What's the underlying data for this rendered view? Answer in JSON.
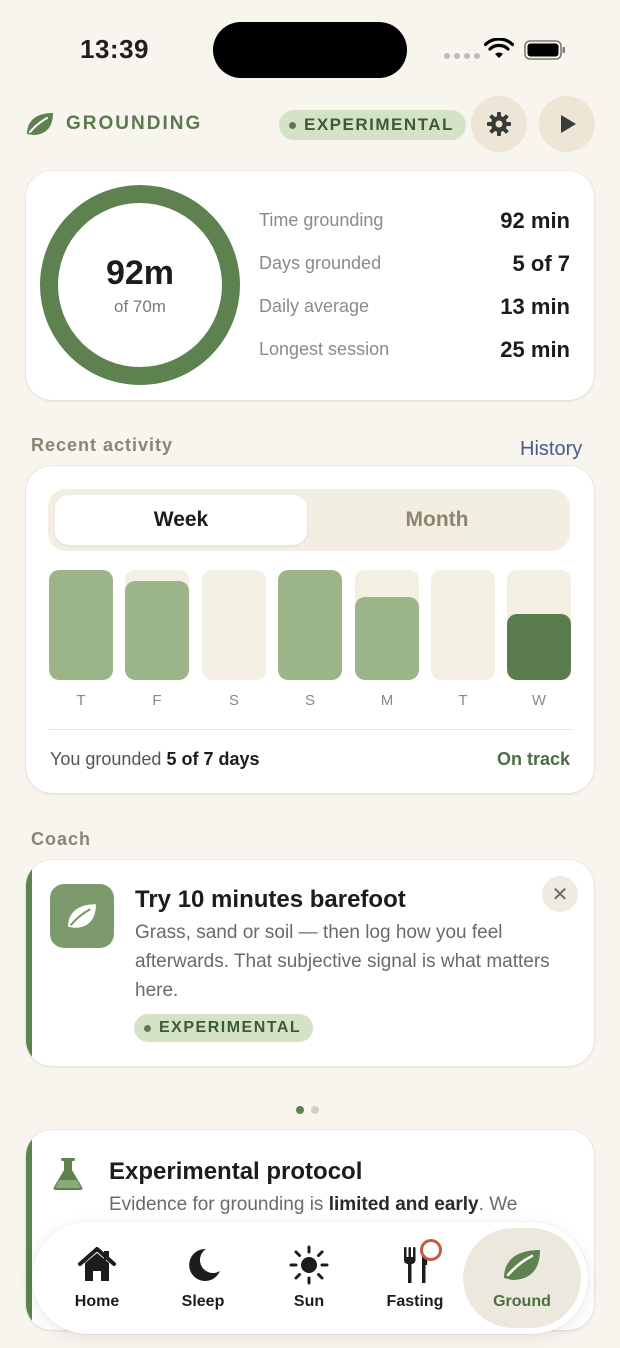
{
  "status_bar": {
    "time": "13:39"
  },
  "header": {
    "title": "GROUNDING",
    "badge": "EXPERIMENTAL"
  },
  "summary": {
    "ring_value": "92m",
    "ring_sub": "of 70m",
    "stats": [
      {
        "label": "Time grounding",
        "value": "92 min"
      },
      {
        "label": "Days grounded",
        "value": "5 of 7"
      },
      {
        "label": "Daily average",
        "value": "13 min"
      },
      {
        "label": "Longest session",
        "value": "25 min"
      }
    ]
  },
  "activity": {
    "section_label": "Recent activity",
    "history_link": "History",
    "tabs": {
      "week": "Week",
      "month": "Month"
    },
    "days": [
      {
        "label": "T",
        "level": 1.0,
        "today": false
      },
      {
        "label": "F",
        "level": 0.9,
        "today": false
      },
      {
        "label": "S",
        "level": 0.0,
        "today": false
      },
      {
        "label": "S",
        "level": 1.0,
        "today": false
      },
      {
        "label": "M",
        "level": 0.75,
        "today": false
      },
      {
        "label": "T",
        "level": 0.0,
        "today": false
      },
      {
        "label": "W",
        "level": 0.6,
        "today": true
      }
    ],
    "footer_prefix": "You grounded ",
    "footer_bold": "5 of 7 days",
    "status": "On track"
  },
  "coach": {
    "section_label": "Coach",
    "title": "Try 10 minutes barefoot",
    "body": "Grass, sand or soil — then log how you feel afterwards. That subjective signal is what matters here.",
    "badge": "EXPERIMENTAL",
    "close": "✕"
  },
  "protocol": {
    "title": "Experimental protocol",
    "body_prefix": "Evidence for grounding is ",
    "body_bold": "limited and early",
    "body_suffix": ". We"
  },
  "tab_bar": [
    {
      "label": "Home",
      "icon": "home-icon"
    },
    {
      "label": "Sleep",
      "icon": "moon-icon"
    },
    {
      "label": "Sun",
      "icon": "sun-icon"
    },
    {
      "label": "Fasting",
      "icon": "fork-knife-icon"
    },
    {
      "label": "Ground",
      "icon": "leaf-icon",
      "active": true
    }
  ],
  "colors": {
    "accent": "#5d8250",
    "bar": "#9bb588",
    "today": "#5b7d4e",
    "link": "#4a5a88"
  }
}
